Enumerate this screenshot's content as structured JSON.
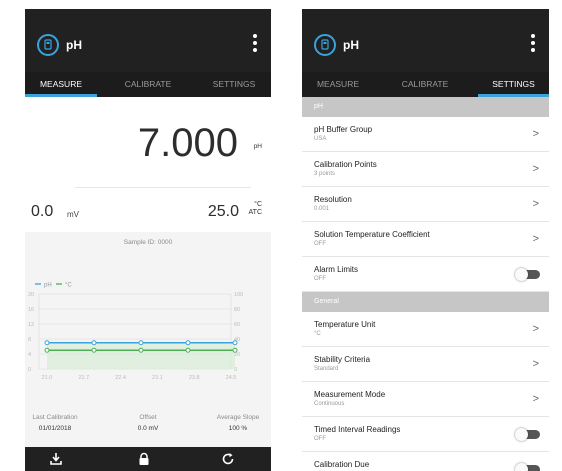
{
  "app": {
    "title": "pH"
  },
  "tabs": [
    "MEASURE",
    "CALIBRATE",
    "SETTINGS"
  ],
  "measure": {
    "ph_value": "7.000",
    "ph_unit": "pH",
    "mv_value": "0.0",
    "mv_unit": "mV",
    "temp_value": "25.0",
    "temp_unit_top": "°C",
    "temp_unit_bottom": "ATC",
    "sample_id": "Sample ID: 0000",
    "last_calibration_label": "Last Calibration",
    "last_calibration_value": "01/01/2018",
    "offset_label": "Offset",
    "offset_value": "0.0 mV",
    "slope_label": "Average Slope",
    "slope_value": "100 %"
  },
  "chart_data": {
    "type": "line",
    "x": [
      "21.0",
      "21.7",
      "22.4",
      "23.1",
      "23.8",
      "24.5"
    ],
    "series": [
      {
        "name": "pH",
        "values": [
          7,
          7,
          7,
          7,
          7,
          7
        ],
        "color": "#3aa3dc"
      },
      {
        "name": "°C",
        "values": [
          25,
          25,
          25,
          25,
          25,
          25
        ],
        "color": "#4caf50"
      }
    ],
    "y_left_ticks": [
      "20",
      "16",
      "12",
      "8",
      "4",
      "0"
    ],
    "y_left_range": [
      0,
      20
    ],
    "y_right_ticks": [
      "100",
      "80",
      "60",
      "40",
      "20",
      "0"
    ],
    "y_right_range": [
      0,
      100
    ],
    "grid": true,
    "legend_position": "top-left"
  },
  "settings": {
    "sections": [
      {
        "header": "pH",
        "rows": [
          {
            "title": "pH Buffer Group",
            "sub": "USA",
            "control": "chevron"
          },
          {
            "title": "Calibration Points",
            "sub": "3 points",
            "control": "chevron"
          },
          {
            "title": "Resolution",
            "sub": "0.001",
            "control": "chevron"
          },
          {
            "title": "Solution Temperature Coefficient",
            "sub": "OFF",
            "control": "chevron"
          },
          {
            "title": "Alarm Limits",
            "sub": "OFF",
            "control": "toggle"
          }
        ]
      },
      {
        "header": "General",
        "rows": [
          {
            "title": "Temperature Unit",
            "sub": "°C",
            "control": "chevron"
          },
          {
            "title": "Stability Criteria",
            "sub": "Standard",
            "control": "chevron"
          },
          {
            "title": "Measurement Mode",
            "sub": "Continuous",
            "control": "chevron"
          },
          {
            "title": "Timed Interval Readings",
            "sub": "OFF",
            "control": "toggle"
          },
          {
            "title": "Calibration Due",
            "sub": "",
            "control": "toggle"
          }
        ]
      }
    ]
  },
  "icons": {
    "logo": "meter-icon",
    "overflow": "more-vert-icon",
    "bottom": [
      "download-icon",
      "lock-icon",
      "refresh-icon"
    ]
  },
  "colors": {
    "accent": "#3aa3dc",
    "appbar": "#212121",
    "ph_series": "#3aa3dc",
    "temp_series": "#4caf50"
  }
}
